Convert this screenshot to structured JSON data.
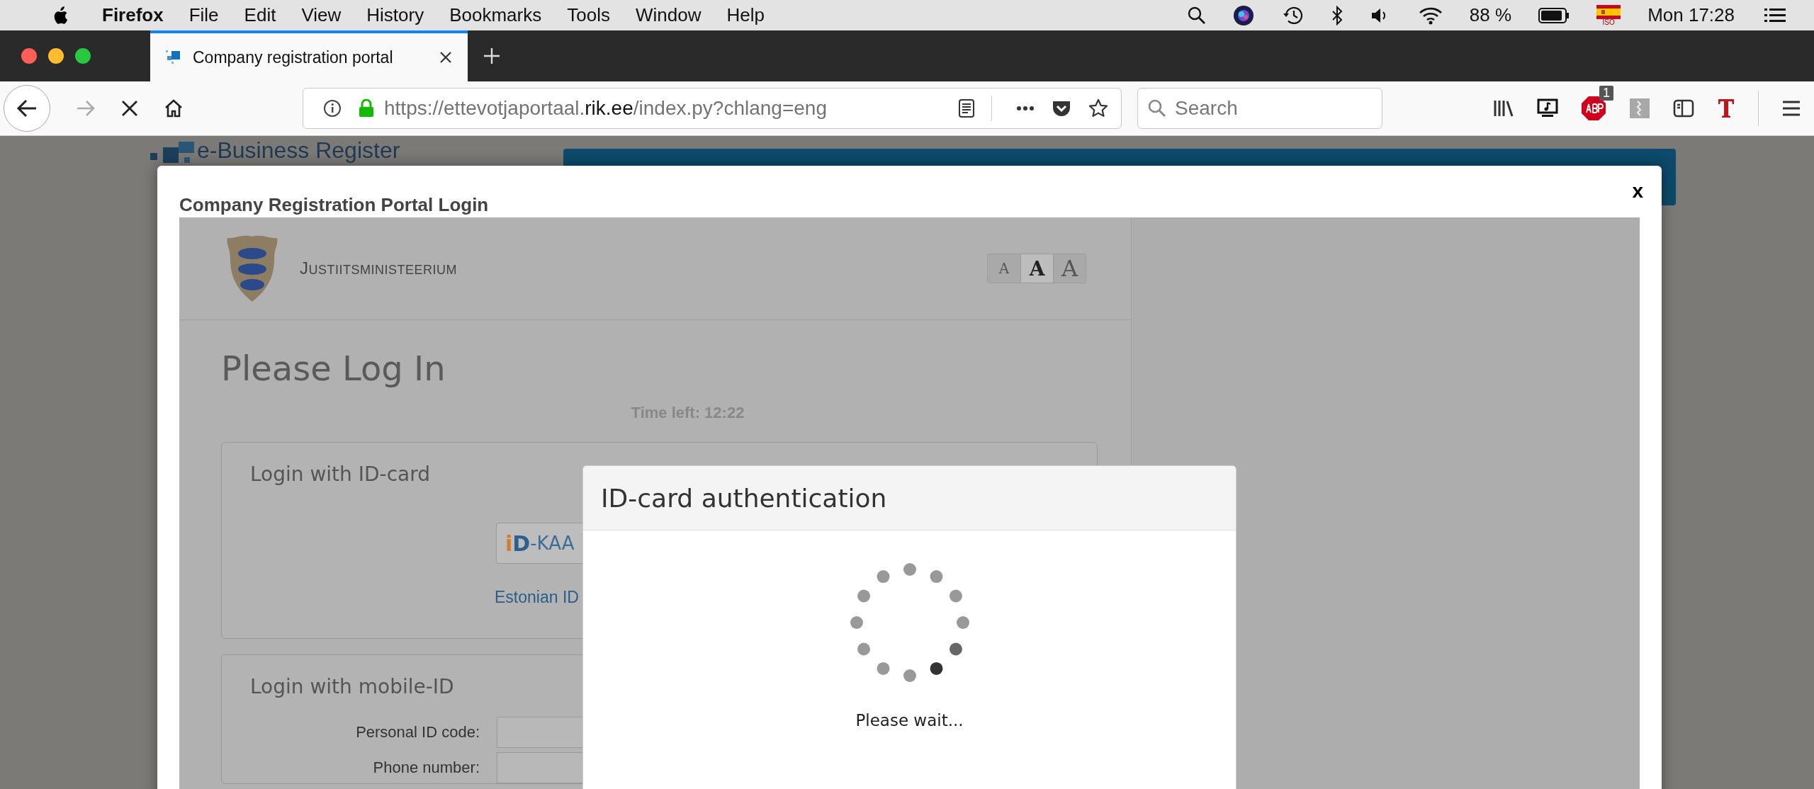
{
  "menu_bar": {
    "app_name": "Firefox",
    "menus": [
      "File",
      "Edit",
      "View",
      "History",
      "Bookmarks",
      "Tools",
      "Window",
      "Help"
    ],
    "battery": "88 %",
    "input_source": "ISO",
    "clock": "Mon 17:28"
  },
  "tabs": [
    {
      "title": "Company registration portal",
      "selected": true
    }
  ],
  "toolbar": {
    "url": {
      "prefix": "https://ettevotjaportaal.",
      "domain": "rik.ee",
      "path": "/index.py?chlang=eng"
    },
    "search": {
      "placeholder": "Search"
    },
    "adblock_count": "1"
  },
  "background_page": {
    "site_title": "e-Business Register"
  },
  "modal": {
    "title": "Company Registration Portal Login",
    "close": "x",
    "ministry": "JUSTIITSMINISTEERIUM",
    "font_size_buttons": [
      {
        "label": "A",
        "selected": false
      },
      {
        "label": "A",
        "selected": true
      },
      {
        "label": "A",
        "selected": false
      }
    ],
    "heading": "Please Log In",
    "time_left": "Time left: 12:22",
    "sections": [
      {
        "kind": "id_card",
        "title": "Login with ID-card",
        "button_logo": "iD",
        "button_label": "-KAA",
        "link": "Estonian ID"
      },
      {
        "kind": "mobile_id",
        "title": "Login with mobile-ID",
        "fields": [
          {
            "label": "Personal ID code:"
          },
          {
            "label": "Phone number:"
          }
        ]
      }
    ]
  },
  "dialog": {
    "title": "ID-card authentication",
    "status": "Please wait..."
  }
}
